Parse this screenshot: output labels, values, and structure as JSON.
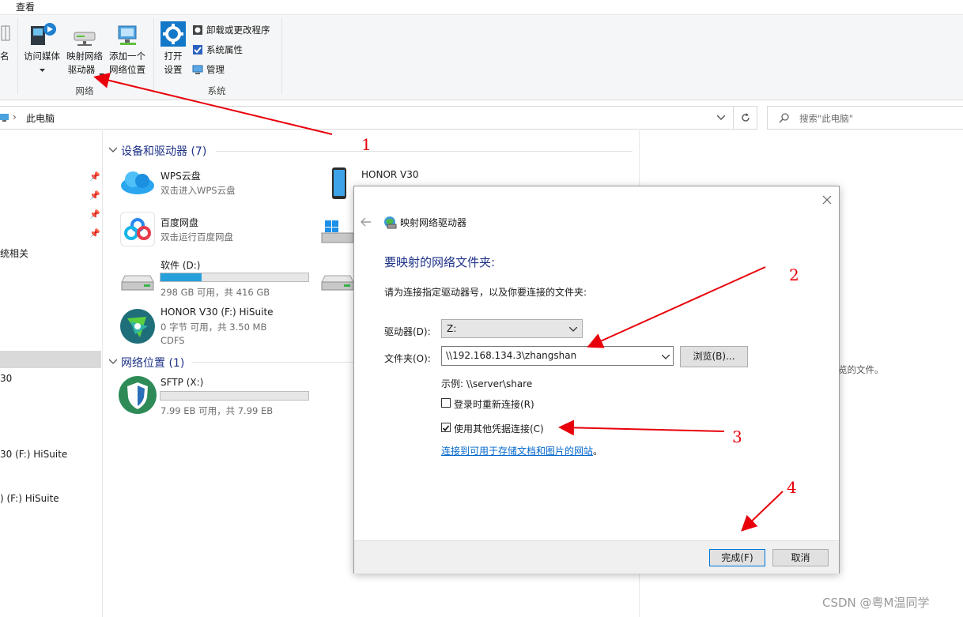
{
  "ribbon": {
    "tab_view": "查看",
    "cut_label": "名",
    "media_label": "访问媒体",
    "map_drive_line1": "映射网络",
    "map_drive_line2": "驱动器",
    "add_location_line1": "添加一个",
    "add_location_line2": "网络位置",
    "open_settings_line1": "打开",
    "open_settings_line2": "设置",
    "uninstall": "卸载或更改程序",
    "sys_props": "系统属性",
    "manage": "管理",
    "group_network": "网络",
    "group_system": "系统"
  },
  "address": {
    "path": "此电脑",
    "search_placeholder": "搜索\"此电脑\""
  },
  "nav": {
    "item_sys": "统相关",
    "item_v30": "30",
    "item_hisuite1": "30 (F:) HiSuite",
    "item_hisuite2": ") (F:) HiSuite"
  },
  "devices": {
    "title": "设备和驱动器 (7)",
    "items": [
      {
        "name": "WPS云盘",
        "sub": "双击进入WPS云盘"
      },
      {
        "name": "百度网盘",
        "sub": "双击运行百度网盘"
      },
      {
        "name": "软件 (D:)",
        "sub": "298 GB 可用，共 416 GB",
        "fill": 0.28
      },
      {
        "name": "HONOR V30 (F:) HiSuite",
        "sub": "0 字节 可用，共 3.50 MB",
        "sub2": "CDFS"
      },
      {
        "name": "HONOR V30"
      }
    ]
  },
  "netloc": {
    "title": "网络位置 (1)",
    "items": [
      {
        "name": "SFTP (X:)",
        "sub": "7.99 EB 可用，共 7.99 EB",
        "fill": 0.0
      }
    ]
  },
  "details_text": "览的文件。",
  "dialog": {
    "title": "映射网络驱动器",
    "heading": "要映射的网络文件夹:",
    "instruction": "请为连接指定驱动器号，以及你要连接的文件夹:",
    "drive_label": "驱动器(D):",
    "drive_value": "Z:",
    "folder_label": "文件夹(O):",
    "folder_value": "\\\\192.168.134.3\\zhangshan",
    "browse": "浏览(B)...",
    "example": "示例: \\\\server\\share",
    "reconnect_label": "登录时重新连接(R)",
    "reconnect_checked": false,
    "credentials_label": "使用其他凭据连接(C)",
    "credentials_checked": true,
    "link": "连接到可用于存储文档和图片的网站",
    "link_suffix": "。",
    "finish": "完成(F)",
    "cancel": "取消"
  },
  "annotations": [
    "1",
    "2",
    "3",
    "4"
  ],
  "watermark": "CSDN @粤M温同学",
  "colors": {
    "accent": "#26a0da",
    "arrow": "#e8000b",
    "section_title": "#1e3287",
    "link": "#0066cc"
  }
}
